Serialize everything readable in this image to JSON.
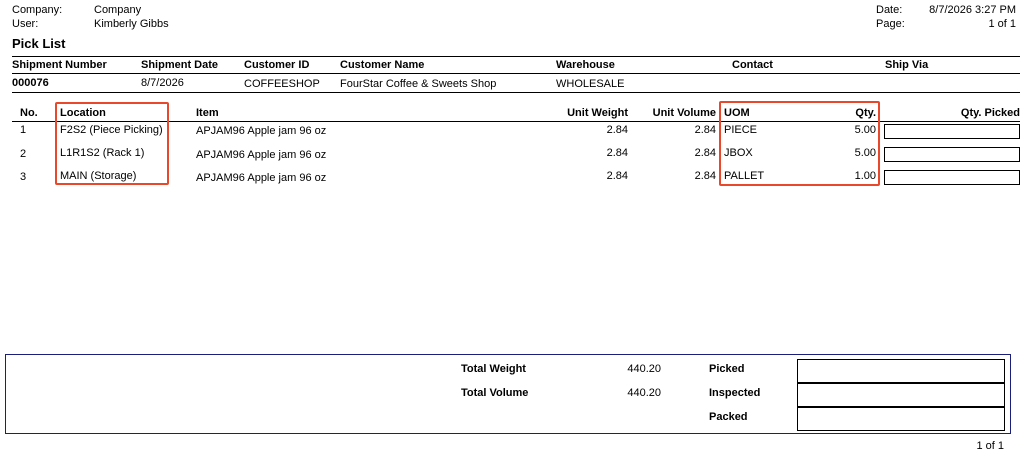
{
  "header": {
    "company_label": "Company:",
    "company_value": "Company",
    "user_label": "User:",
    "user_value": "Kimberly Gibbs",
    "date_label": "Date:",
    "date_value": "8/7/2026 3:27 PM",
    "page_label": "Page:",
    "page_value": "1 of 1"
  },
  "title": "Pick List",
  "shipment": {
    "headers": {
      "number": "Shipment Number",
      "date": "Shipment Date",
      "customer_id": "Customer ID",
      "customer_name": "Customer Name",
      "warehouse": "Warehouse",
      "contact": "Contact",
      "ship_via": "Ship Via"
    },
    "values": {
      "number": "000076",
      "date": "8/7/2026",
      "customer_id": "COFFEESHOP",
      "customer_name": "FourStar Coffee & Sweets Shop",
      "warehouse": "WHOLESALE",
      "contact": "",
      "ship_via": ""
    }
  },
  "lines": {
    "headers": {
      "no": "No.",
      "location": "Location",
      "item": "Item",
      "unit_weight": "Unit Weight",
      "unit_volume": "Unit Volume",
      "uom": "UOM",
      "qty": "Qty.",
      "qty_picked": "Qty. Picked"
    },
    "rows": [
      {
        "no": "1",
        "location": "F2S2 (Piece Picking)",
        "item": "APJAM96 Apple jam 96 oz",
        "unit_weight": "2.84",
        "unit_volume": "2.84",
        "uom": "PIECE",
        "qty": "5.00"
      },
      {
        "no": "2",
        "location": "L1R1S2 (Rack 1)",
        "item": "APJAM96 Apple jam 96 oz",
        "unit_weight": "2.84",
        "unit_volume": "2.84",
        "uom": "JBOX",
        "qty": "5.00"
      },
      {
        "no": "3",
        "location": "MAIN (Storage)",
        "item": "APJAM96 Apple jam 96 oz",
        "unit_weight": "2.84",
        "unit_volume": "2.84",
        "uom": "PALLET",
        "qty": "1.00"
      }
    ]
  },
  "totals": {
    "weight_label": "Total Weight",
    "weight_value": "440.20",
    "volume_label": "Total Volume",
    "volume_value": "440.20",
    "picked_label": "Picked",
    "inspected_label": "Inspected",
    "packed_label": "Packed"
  },
  "footer": {
    "page": "1 of 1"
  },
  "colors": {
    "highlight": "#e8492a",
    "footer_border": "#1a1f7a"
  }
}
